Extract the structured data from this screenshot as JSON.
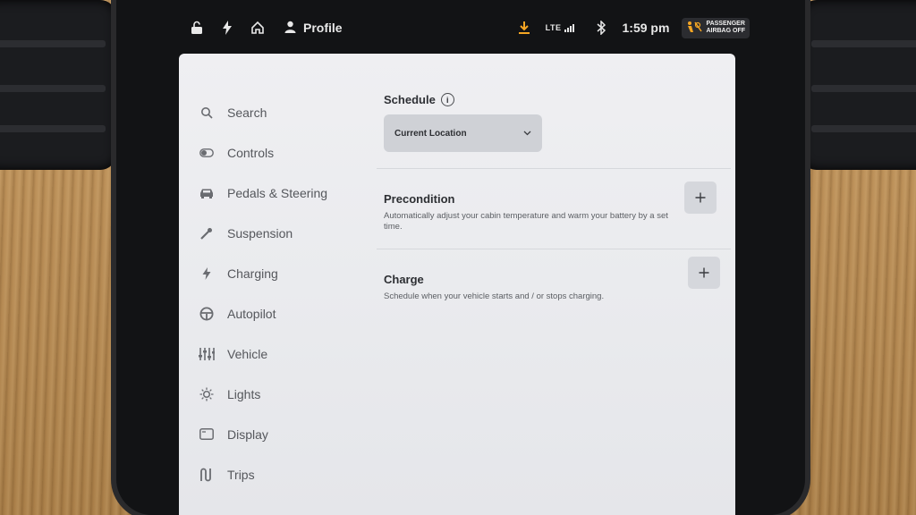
{
  "status_bar": {
    "profile_label": "Profile",
    "network": "LTE",
    "time": "1:59 pm",
    "airbag_line1": "PASSENGER",
    "airbag_line2": "AIRBAG OFF",
    "download_color": "#f5a623"
  },
  "sidebar": {
    "items": [
      {
        "label": "Search",
        "icon": "search-icon"
      },
      {
        "label": "Controls",
        "icon": "toggle-icon"
      },
      {
        "label": "Pedals & Steering",
        "icon": "car-icon"
      },
      {
        "label": "Suspension",
        "icon": "wrench-icon"
      },
      {
        "label": "Charging",
        "icon": "bolt-icon"
      },
      {
        "label": "Autopilot",
        "icon": "steering-wheel-icon"
      },
      {
        "label": "Vehicle",
        "icon": "sliders-icon"
      },
      {
        "label": "Lights",
        "icon": "sun-icon"
      },
      {
        "label": "Display",
        "icon": "display-icon"
      },
      {
        "label": "Trips",
        "icon": "trips-icon"
      }
    ]
  },
  "schedule": {
    "label": "Schedule",
    "location_value": "Current Location"
  },
  "precondition": {
    "title": "Precondition",
    "description": "Automatically adjust your cabin temperature and warm your battery by a set time."
  },
  "charge": {
    "title": "Charge",
    "description": "Schedule when your vehicle starts and / or stops charging."
  }
}
